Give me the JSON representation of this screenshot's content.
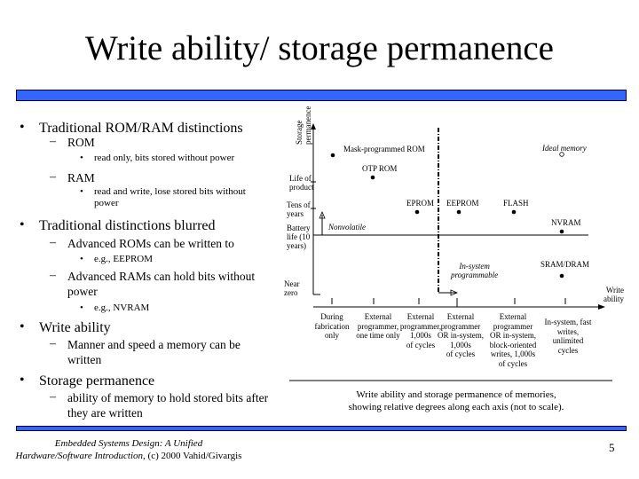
{
  "slide": {
    "title": "Write ability/ storage permanence",
    "accent_color": "#3366ff",
    "page_number": "5",
    "footer": {
      "line1": "Embedded Systems Design: A Unified",
      "line2_italic": "Hardware/Software Introduction,",
      "line2_plain": " (c) 2000 Vahid/Givargis"
    }
  },
  "bullets": [
    {
      "level": 1,
      "marker": "•",
      "text": "Traditional ROM/RAM distinctions"
    },
    {
      "level": 2,
      "marker": "–",
      "text": "ROM"
    },
    {
      "level": 3,
      "marker": "•",
      "text": "read only, bits stored without power"
    },
    {
      "level": 2,
      "marker": "–",
      "text": "RAM"
    },
    {
      "level": 3,
      "marker": "•",
      "text": "read and write, lose stored bits without power"
    },
    {
      "level": 1,
      "marker": "•",
      "text": "Traditional distinctions blurred"
    },
    {
      "level": 2,
      "marker": "–",
      "text": "Advanced ROMs can be written to"
    },
    {
      "level": 3,
      "marker": "•",
      "text": "e.g., EEPROM"
    },
    {
      "level": 2,
      "marker": "–",
      "text": "Advanced RAMs can hold bits without power"
    },
    {
      "level": 3,
      "marker": "•",
      "text": "e.g., NVRAM"
    },
    {
      "level": 1,
      "marker": "•",
      "text": "Write ability"
    },
    {
      "level": 2,
      "marker": "–",
      "text": "Manner and speed a memory can be written"
    },
    {
      "level": 1,
      "marker": "•",
      "text": "Storage permanence"
    },
    {
      "level": 2,
      "marker": "–",
      "text": "ability of memory to hold stored bits after they are written"
    }
  ],
  "chart_data": {
    "type": "scatter",
    "title": "",
    "caption": [
      "Write ability and storage permanence of memories,",
      "showing relative degrees along each axis (not to scale)."
    ],
    "xlabel": "Write ability",
    "ylabel": "Storage permanence",
    "x_categories": [
      "During fabrication only",
      "External programmer, one time only",
      "External programmer, 1,000s of cycles",
      "External programmer OR in-system, 1,000s of cycles",
      "External programmer OR in-system, block-oriented writes, 1,000s of cycles",
      "In-system, fast writes, unlimited cycles"
    ],
    "y_categories": [
      "Near zero",
      "Battery life (10 years)",
      "Tens of years",
      "Life of product"
    ],
    "points": [
      {
        "name": "Mask-programmed ROM",
        "x": 0,
        "y": 4.3,
        "style": "filled"
      },
      {
        "name": "OTP ROM",
        "x": 1,
        "y": 3.5,
        "style": "filled"
      },
      {
        "name": "EPROM",
        "x": 2,
        "y": 2.7,
        "style": "filled"
      },
      {
        "name": "EEPROM",
        "x": 3,
        "y": 2.7,
        "style": "filled"
      },
      {
        "name": "FLASH",
        "x": 4,
        "y": 2.7,
        "style": "filled"
      },
      {
        "name": "NVRAM",
        "x": 5,
        "y": 2.0,
        "style": "filled"
      },
      {
        "name": "SRAM/DRAM",
        "x": 5,
        "y": 0.5,
        "style": "filled"
      },
      {
        "name": "Ideal memory",
        "x": 5,
        "y": 4.3,
        "style": "hollow",
        "italic": true
      }
    ],
    "annotations": [
      {
        "text": "Nonvolatile",
        "italic": true
      },
      {
        "text": "In-system programmable",
        "italic": true
      }
    ],
    "x_category_label_lines": [
      [
        "During",
        "fabrication",
        "only"
      ],
      [
        "External",
        "programmer,",
        "one time only"
      ],
      [
        "External",
        "programmer,",
        "1,000s",
        "of cycles"
      ],
      [
        "External",
        "programmer",
        "OR in-system,",
        "1,000s",
        "of cycles"
      ],
      [
        "External",
        "programmer",
        "OR in-system,",
        "block-oriented",
        "writes, 1,000s",
        "of cycles"
      ],
      [
        "In-system, fast",
        "writes,",
        "unlimited",
        "cycles"
      ]
    ],
    "y_category_label_lines": [
      [
        "Near",
        "zero"
      ],
      [
        "Battery",
        "life (10",
        "years)"
      ],
      [
        "Tens of",
        "years"
      ],
      [
        "Life of",
        "product"
      ]
    ],
    "ylabel_lines": [
      "Storage",
      "permanence"
    ],
    "xlabel_lines": [
      "Write",
      "ability"
    ],
    "in_system_lines": [
      "In-system",
      "programmable"
    ]
  }
}
